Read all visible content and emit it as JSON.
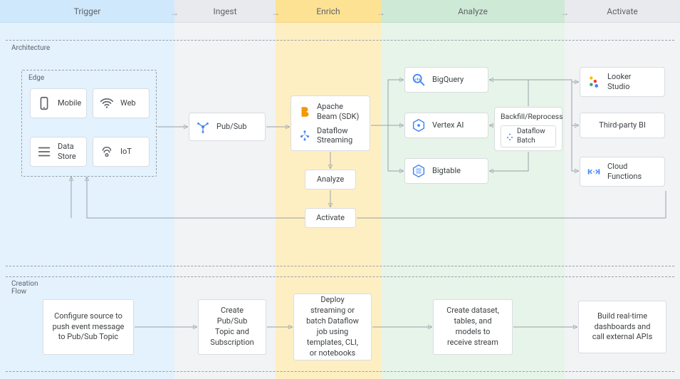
{
  "columns": {
    "trigger": "Trigger",
    "ingest": "Ingest",
    "enrich": "Enrich",
    "analyze": "Analyze",
    "activate": "Activate"
  },
  "sections": {
    "architecture": "Architecture",
    "creation_flow": "Creation\nFlow"
  },
  "edge": {
    "label": "Edge",
    "items": {
      "mobile": "Mobile",
      "web": "Web",
      "data_store": "Data\nStore",
      "iot": "IoT"
    }
  },
  "ingest": {
    "pubsub": "Pub/Sub"
  },
  "enrich": {
    "beam_sdk": "Apache\nBeam (SDK)",
    "dataflow_streaming": "Dataflow\nStreaming",
    "analyze": "Analyze",
    "activate": "Activate"
  },
  "analyze": {
    "bigquery": "BigQuery",
    "vertex": "Vertex AI",
    "bigtable": "Bigtable",
    "backfill": "Backfill/Reprocess",
    "dataflow_batch": "Dataflow Batch"
  },
  "activate": {
    "looker": "Looker\nStudio",
    "third_party_bi": "Third-party BI",
    "cloud_functions": "Cloud\nFunctions"
  },
  "creation_flow": {
    "trigger": "Configure source to push event message to Pub/Sub Topic",
    "ingest": "Create Pub/Sub Topic and Subscription",
    "enrich": "Deploy streaming or batch Dataflow job using templates, CLI, or notebooks",
    "analyze": "Create dataset, tables, and models to receive stream",
    "activate": "Build real-time dashboards and call external APIs"
  },
  "colors": {
    "trigger_bg": "#e3f2fd",
    "ingest_bg": "#f1f3f4",
    "enrich_bg": "#feefc3",
    "analyze_bg": "#e6f4ea",
    "activate_bg": "#f1f3f4",
    "arrow": "#9aa0a6",
    "node_border": "#dadce0",
    "text": "#3c4043",
    "beam_orange": "#f29900",
    "gcp_blue": "#4285f4",
    "gcp_red": "#ea4335",
    "gcp_green": "#34a853",
    "gcp_yellow": "#fbbc04"
  }
}
